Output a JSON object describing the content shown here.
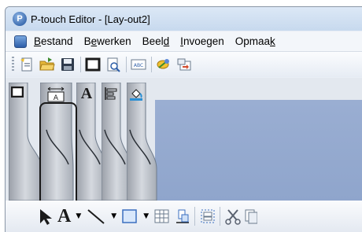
{
  "window": {
    "title": "P-touch Editor - [Lay-out2]",
    "app_icon_glyph": "P"
  },
  "menu": {
    "items": [
      {
        "pre": "",
        "u": "B",
        "post": "estand"
      },
      {
        "pre": "B",
        "u": "e",
        "post": "werken"
      },
      {
        "pre": "Beel",
        "u": "d",
        "post": ""
      },
      {
        "pre": "",
        "u": "I",
        "post": "nvoegen"
      },
      {
        "pre": "Opmaa",
        "u": "k",
        "post": ""
      }
    ]
  },
  "toolbar_top": {
    "icons": [
      "new-layout-icon",
      "open-folder-icon",
      "save-icon",
      "frame-icon",
      "print-preview-icon",
      "spell-check-icon",
      "database-icon",
      "transfer-icon"
    ]
  },
  "side_tabs": [
    {
      "name": "paper-properties-tab",
      "glyph": "❐"
    },
    {
      "name": "text-properties-tab",
      "glyph": "A"
    },
    {
      "name": "font-properties-tab",
      "glyph": "A"
    },
    {
      "name": "layout-align-tab",
      "glyph": "⊫"
    },
    {
      "name": "color-fill-tab",
      "glyph": "◈"
    }
  ],
  "toolbar_bottom": {
    "text_tool_glyph": "A",
    "icons": [
      "select-arrow-icon",
      "text-tool-icon",
      "line-tool-icon",
      "rectangle-tool-icon",
      "table-tool-icon",
      "arrange-icon",
      "group-icon",
      "cut-icon",
      "copy-icon"
    ]
  },
  "colors": {
    "highlight_border": "#1a1a1a",
    "canvas_blue": "#9aaed2"
  }
}
